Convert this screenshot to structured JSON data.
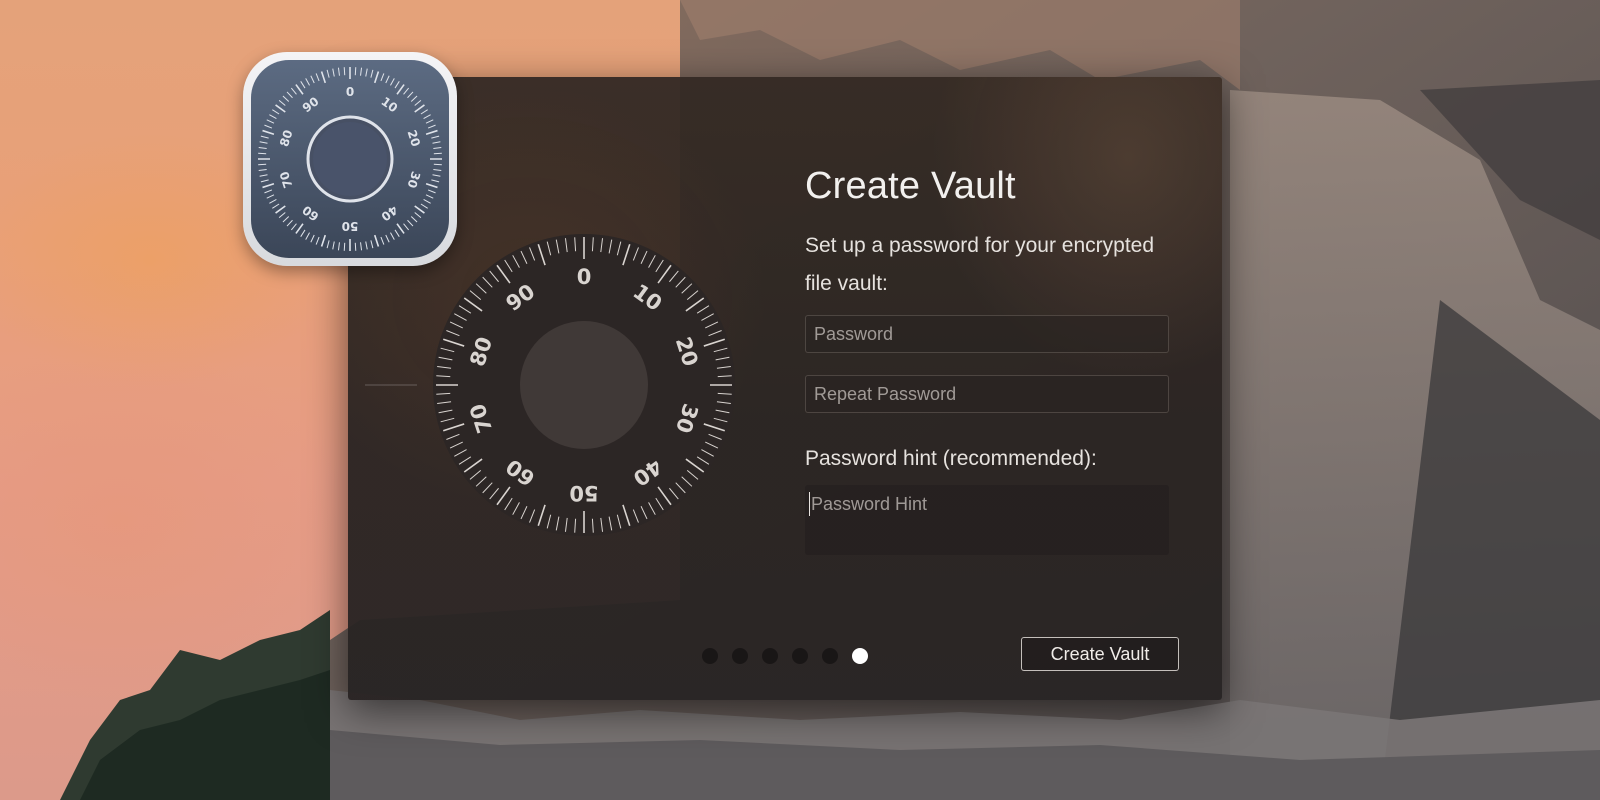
{
  "app_icon": {
    "numbers": [
      "0",
      "10",
      "20",
      "30",
      "40",
      "50",
      "60",
      "70",
      "80",
      "90"
    ]
  },
  "dial": {
    "numbers": [
      "0",
      "10",
      "20",
      "30",
      "40",
      "50",
      "60",
      "70",
      "80",
      "90"
    ]
  },
  "vault": {
    "title": "Create Vault",
    "subtitle": "Set up a password for your encrypted file vault:",
    "password_placeholder": "Password",
    "repeat_placeholder": "Repeat Password",
    "hint_label": "Password hint (recommended):",
    "hint_placeholder": "Password Hint",
    "create_button": "Create Vault"
  },
  "pagination": {
    "total": 6,
    "active_index": 5
  },
  "colors": {
    "sky": "#e6a07e",
    "window": "#2e2624",
    "icon_face": "#4a5568",
    "text": "#f2f0ee"
  }
}
